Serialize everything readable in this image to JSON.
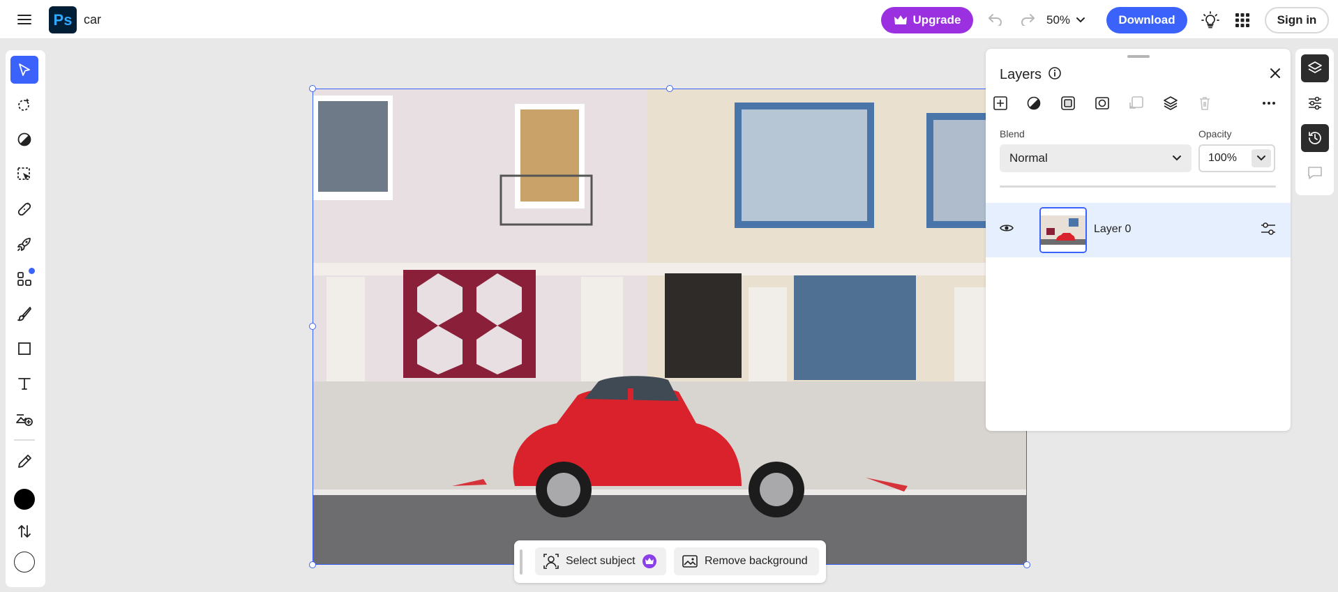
{
  "app": {
    "logo_text": "Ps",
    "document_title": "car"
  },
  "topbar": {
    "upgrade_label": "Upgrade",
    "zoom_level": "50%",
    "download_label": "Download",
    "signin_label": "Sign in"
  },
  "left_toolbar": {
    "tools": [
      "move-tool",
      "quick-selection-tool",
      "adjustments-tool",
      "object-selection-tool",
      "healing-tool",
      "quick-actions-tool",
      "add-ons-tool",
      "brush-tool",
      "shape-tool",
      "text-tool",
      "generative-fill-tool",
      "eyedropper-tool",
      "foreground-color",
      "swap-colors",
      "background-color"
    ],
    "foreground_color": "#000000",
    "background_color": "#ffffff",
    "active_tool": "move-tool"
  },
  "context_bar": {
    "select_subject_label": "Select subject",
    "remove_background_label": "Remove background"
  },
  "layers_panel": {
    "title": "Layers",
    "blend_label": "Blend",
    "blend_value": "Normal",
    "opacity_label": "Opacity",
    "opacity_value": "100%",
    "layers": [
      {
        "name": "Layer 0",
        "visible": true,
        "selected": true
      }
    ]
  },
  "colors": {
    "accent": "#3b63fb",
    "upgrade": "#9b30e0",
    "selected_row": "#e6effd"
  }
}
